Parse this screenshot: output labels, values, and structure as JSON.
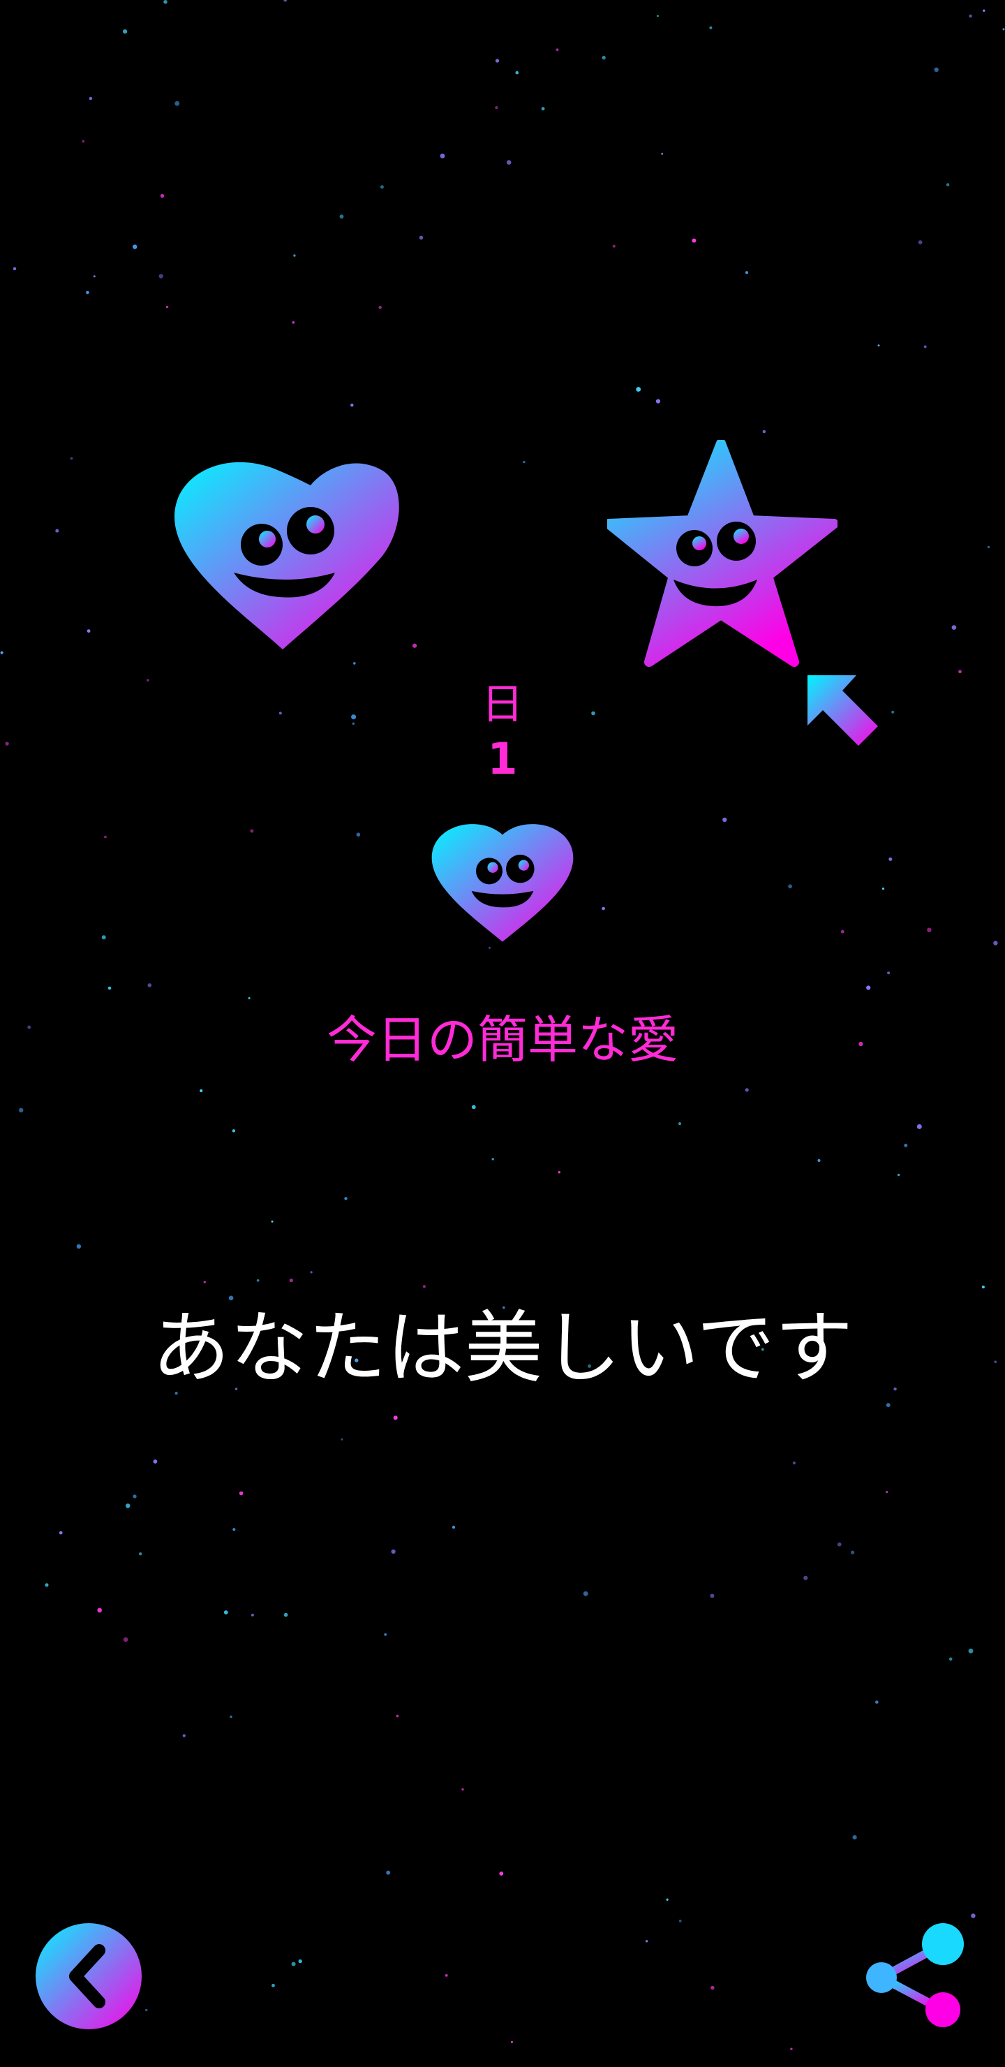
{
  "day": {
    "label": "日",
    "number": "1"
  },
  "love_title": "今日の簡単な愛",
  "message": "あなたは美しいです",
  "icons": {
    "heart_large": "smiling-heart",
    "star": "smiling-star",
    "arrow": "arrow-up-left",
    "heart_small": "smiling-heart",
    "back": "chevron-left",
    "share": "share"
  },
  "colors": {
    "background": "#000000",
    "gradient_start": "#00f5ff",
    "gradient_end": "#ff00e6",
    "accent_text": "#ff2bd6",
    "message_text": "#ffffff"
  }
}
